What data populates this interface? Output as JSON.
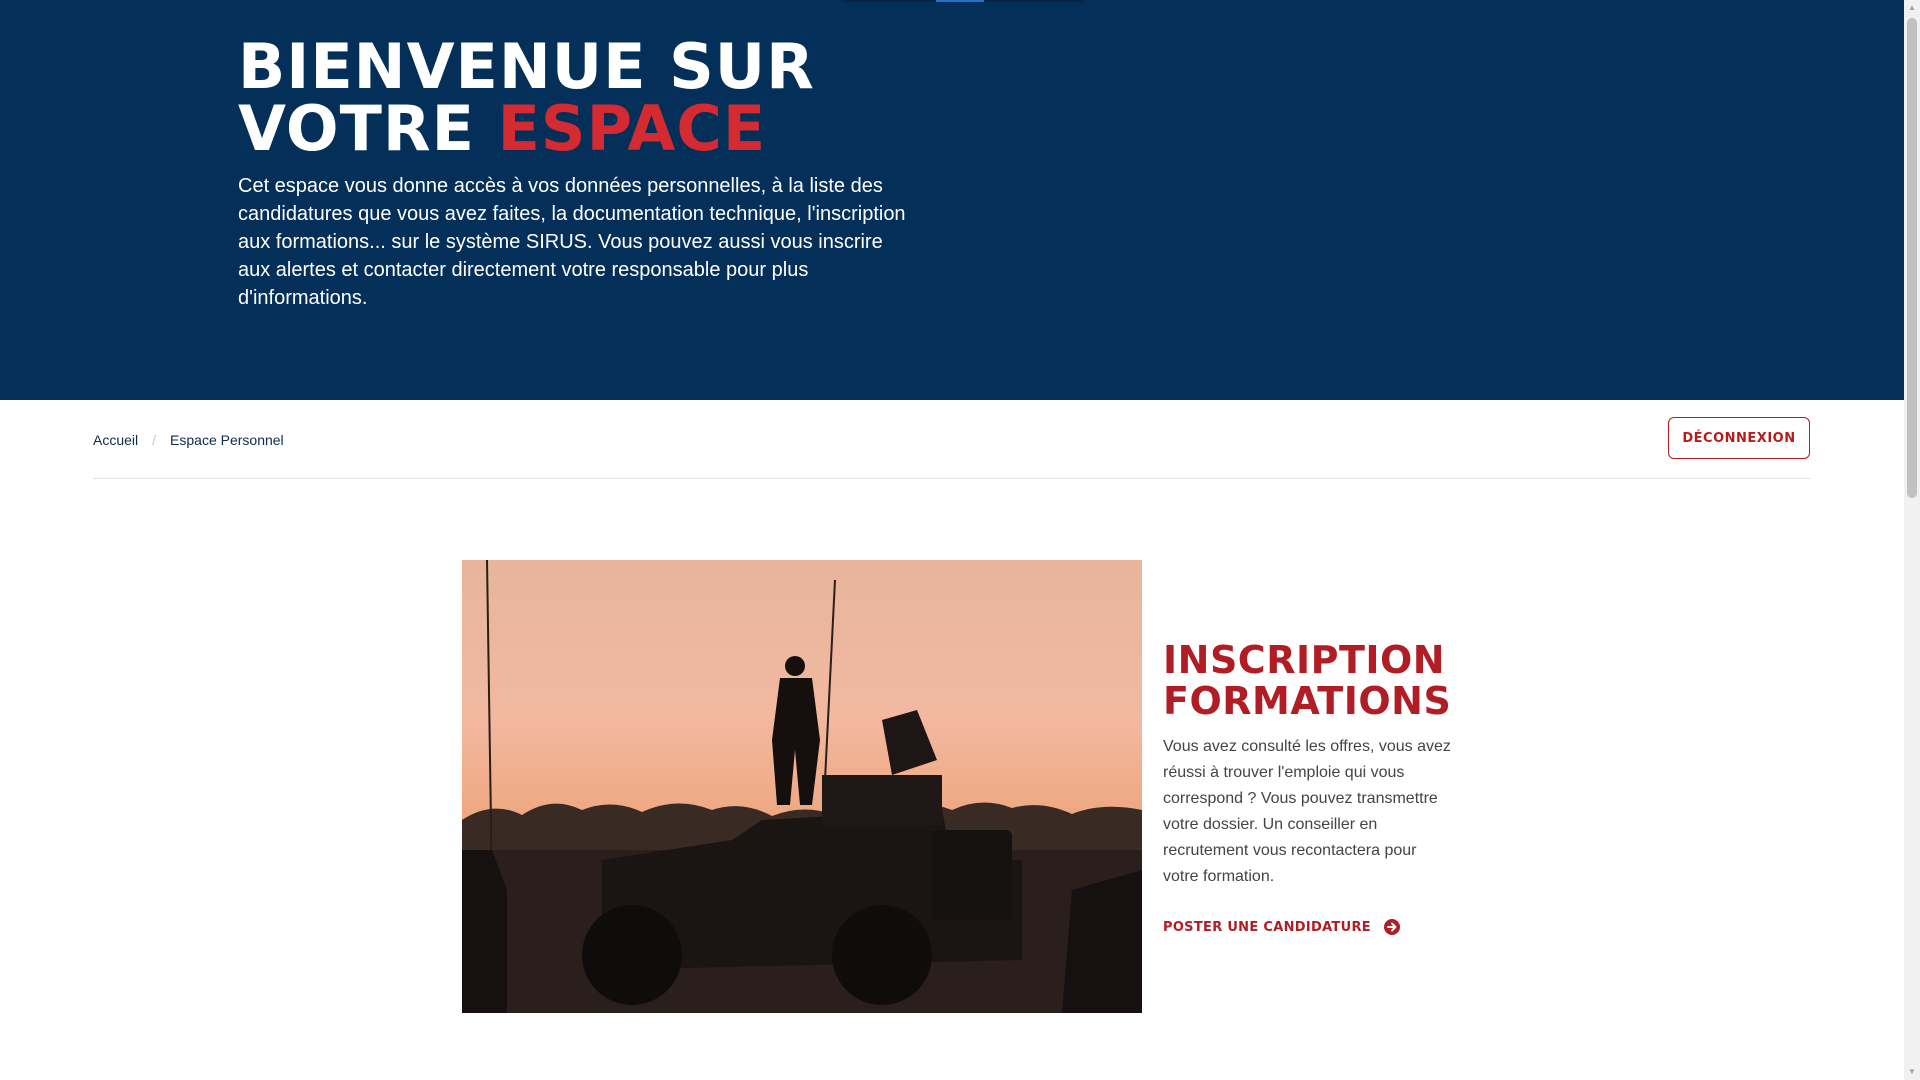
{
  "hero": {
    "title_line1": "BIENVENUE SUR",
    "title_line2_prefix": "VOTRE ",
    "title_line2_accent": "ESPACE",
    "description": "Cet espace vous donne accès à vos données personnelles, à la liste des candidatures que vous avez faites, la documentation technique, l'inscription aux formations... sur le système SIRUS. Vous pouvez aussi vous inscrire aux alertes et contacter directement votre responsable pour plus d'informations."
  },
  "breadcrumb": {
    "items": [
      "Accueil",
      "Espace Personnel"
    ],
    "separator": "/"
  },
  "header": {
    "logout_label": "DÉCONNEXION"
  },
  "card": {
    "title_line1": "INSCRIPTION",
    "title_line2": "FORMATIONS",
    "description": "Vous avez consulté les offres, vous avez réussi à trouver l'emploie qui vous correspond ? Vous pouvez transmettre votre dossier. Un conseiller en recrutement vous recontactera pour votre formation.",
    "link_label": "POSTER UNE CANDIDATURE",
    "link_icon": "arrow-right-circle-icon"
  },
  "colors": {
    "hero_bg": "#032f59",
    "accent_red": "#d42b33",
    "card_red": "#b11d24"
  }
}
